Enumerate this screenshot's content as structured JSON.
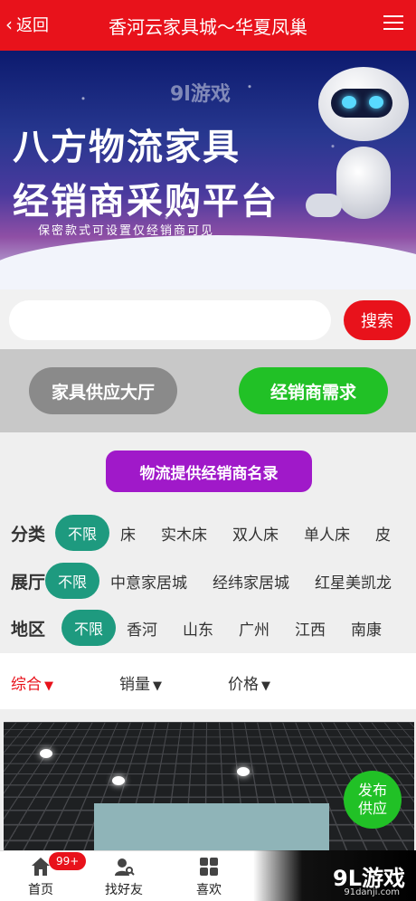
{
  "header": {
    "back_label": "返回",
    "title": "香河云家具城～华夏凤巢"
  },
  "banner": {
    "line1": "八方物流家具",
    "line2": "经销商采购平台",
    "line3": "保密款式可设置仅经销商可见",
    "watermark": "9l游戏"
  },
  "search": {
    "placeholder": "",
    "button": "搜索"
  },
  "tabs": {
    "supply_hall": "家具供应大厅",
    "dealer_demand": "经销商需求"
  },
  "directory_button": "物流提供经销商名录",
  "filters": [
    {
      "label": "分类",
      "selected": "不限",
      "options": [
        "床",
        "实木床",
        "双人床",
        "单人床",
        "皮"
      ]
    },
    {
      "label": "展厅",
      "selected": "不限",
      "options": [
        "中意家居城",
        "经纬家居城",
        "红星美凯龙"
      ]
    },
    {
      "label": "地区",
      "selected": "不限",
      "options": [
        "香河",
        "山东",
        "广州",
        "江西",
        "南康"
      ]
    }
  ],
  "sort": {
    "overall": "综合",
    "sales": "销量",
    "price": "价格",
    "arrow": "▼"
  },
  "publish": {
    "line1": "发布",
    "line2": "供应"
  },
  "tabbar": {
    "home": "首页",
    "friends": "找好友",
    "like": "喜欢",
    "badge": "99+"
  },
  "brand": {
    "logo": "9L游戏",
    "site": "91danji.com"
  },
  "colors": {
    "primary": "#e8121b",
    "green": "#21c126",
    "purple": "#a019c9",
    "teal": "#1e9a7f"
  }
}
